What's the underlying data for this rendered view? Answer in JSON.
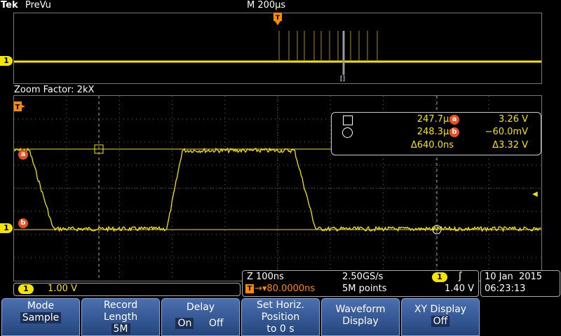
{
  "header": {
    "brand": "Tek",
    "mode": "PreVu",
    "timebase": "M 200µs"
  },
  "overview": {
    "channel_marker": "1",
    "trigger_marker": "T",
    "zoom_marker": "[]"
  },
  "zoom": {
    "label": "Zoom Factor: 2kX",
    "trigger_marker": "T",
    "channel_marker": "1",
    "cursor_a_marker": "a",
    "cursor_b_marker": "b"
  },
  "cursor_readout": {
    "time_a": "247.7µs",
    "time_b": "248.3µs",
    "delta_time": "Δ640.0ns",
    "label_a": "a",
    "label_b": "b",
    "volt_a": "3.26 V",
    "volt_b": "−60.0mV",
    "delta_volt": "Δ3.32 V"
  },
  "channel_scale": {
    "channel": "1",
    "value": "1.00 V"
  },
  "horizontal": {
    "zoom_scale": "Z 100ns",
    "sample_rate": "2.50GS/s",
    "trigger_channel": "1",
    "trigger_slope": "ʃ",
    "trigger_position": "→▾80.0000ns",
    "trigger_icon": "T",
    "record": "5M points",
    "trigger_level": "1.40 V"
  },
  "datetime": {
    "date": "10 Jan  2015",
    "time": "06:23:13"
  },
  "menu": [
    {
      "line1": "Mode",
      "value": "Sample"
    },
    {
      "line1": "Record",
      "line2": "Length",
      "value": "5M"
    },
    {
      "line1": "Delay",
      "on": "On",
      "off": "Off"
    },
    {
      "line1": "Set Horiz.",
      "line2": "Position",
      "line3": "to 0 s"
    },
    {
      "line1": "Waveform",
      "line2": "Display"
    },
    {
      "line1": "XY Display",
      "value": "Off"
    }
  ],
  "colors": {
    "trace": "#f5e300",
    "cursor_marker": "#e85020",
    "trigger_marker": "#ff8a00",
    "menu_bg": "#3a5f9e"
  }
}
